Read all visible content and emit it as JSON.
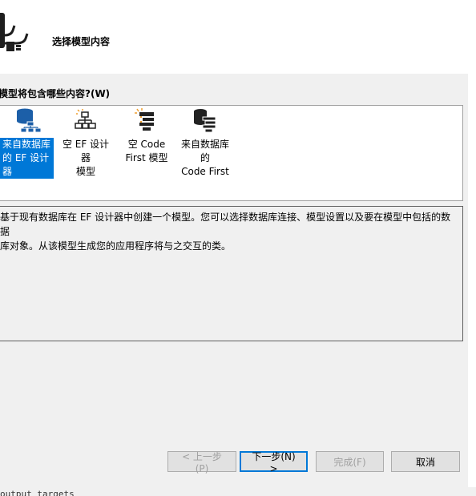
{
  "header": {
    "title": "选择模型内容"
  },
  "question": {
    "label": "模型将包含哪些内容?(W)"
  },
  "templates": [
    {
      "line1": "来自数据库",
      "line2": "的 EF 设计器",
      "icon": "database-designer-icon",
      "selected": true
    },
    {
      "line1": "空 EF 设计器",
      "line2": "模型",
      "icon": "empty-designer-icon",
      "selected": false
    },
    {
      "line1": "空 Code",
      "line2": "First 模型",
      "icon": "empty-code-first-icon",
      "selected": false
    },
    {
      "line1": "来自数据库的",
      "line2": "Code First",
      "icon": "database-code-first-icon",
      "selected": false
    }
  ],
  "description": {
    "text": "基于现有数据库在 EF 设计器中创建一个模型。您可以选择数据库连接、模型设置以及要在模型中包括的数据\n库对象。从该模型生成您的应用程序将与之交互的类。"
  },
  "buttons": {
    "back": "< 上一步(P)",
    "next": "下一步(N) >",
    "finish": "完成(F)",
    "cancel": "取消"
  },
  "bottom_text": "output targets",
  "colors": {
    "selection": "#0078d7",
    "accent_orange": "#f0a030"
  }
}
